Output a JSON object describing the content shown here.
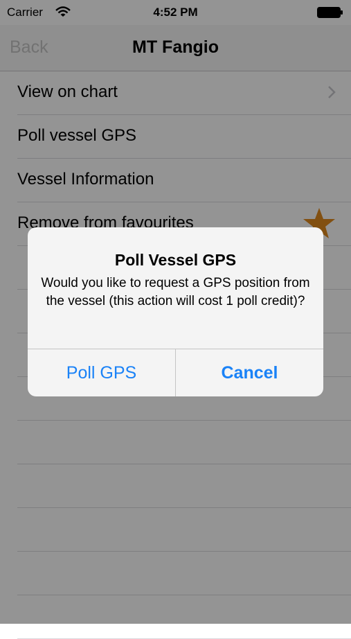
{
  "status_bar": {
    "carrier": "Carrier",
    "time": "4:52 PM",
    "wifi_icon": "wifi-icon",
    "battery_icon": "battery-icon"
  },
  "nav": {
    "back_label": "Back",
    "title": "MT Fangio"
  },
  "list": {
    "items": [
      {
        "label": "View on chart",
        "accessory": "chevron-right-icon"
      },
      {
        "label": "Poll vessel GPS"
      },
      {
        "label": "Vessel Information"
      },
      {
        "label": "Remove from favourites",
        "accessory": "star-icon"
      }
    ]
  },
  "alert": {
    "title": "Poll Vessel GPS",
    "message": "Would you like to request a GPS position from the vessel (this action will cost 1 poll credit)?",
    "buttons": {
      "confirm": "Poll GPS",
      "cancel": "Cancel"
    }
  },
  "colors": {
    "accent": "#1a82f7",
    "star": "#e08a1e",
    "overlay": "rgba(0,0,0,0.42)"
  }
}
